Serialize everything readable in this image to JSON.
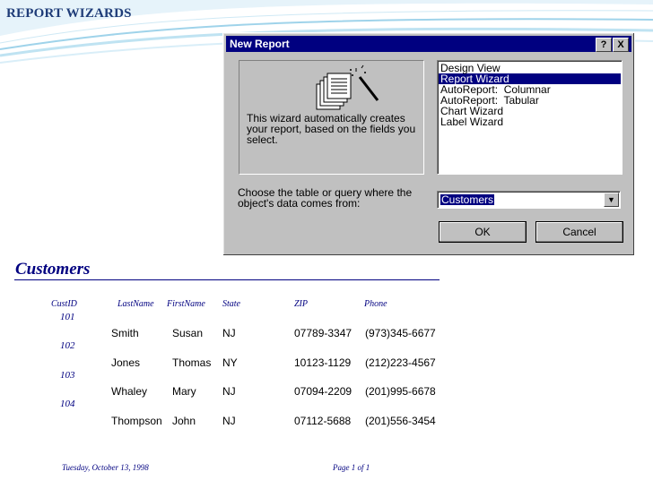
{
  "slide": {
    "title": "REPORT WIZARDS"
  },
  "dialog": {
    "title": "New Report",
    "help_glyph": "?",
    "close_glyph": "X",
    "description": "This wizard automatically creates your report, based on the fields you select.",
    "list_items": [
      "Design View",
      "Report Wizard",
      "AutoReport:  Columnar",
      "AutoReport:  Tabular",
      "Chart Wizard",
      "Label Wizard"
    ],
    "selected_index": 1,
    "choose_label": "Choose the table or query where the object's data comes from:",
    "combo_value": "Customers",
    "ok_label": "OK",
    "cancel_label": "Cancel"
  },
  "report": {
    "title": "Customers",
    "headers": [
      "CustID",
      "LastName",
      "FirstName",
      "State",
      "ZIP",
      "Phone"
    ],
    "rows": [
      {
        "id": "101",
        "last": "Smith",
        "first": "Susan",
        "state": "NJ",
        "zip": "07789-3347",
        "phone": "(973)345-6677"
      },
      {
        "id": "102",
        "last": "Jones",
        "first": "Thomas",
        "state": "NY",
        "zip": "10123-1129",
        "phone": "(212)223-4567"
      },
      {
        "id": "103",
        "last": "Whaley",
        "first": "Mary",
        "state": "NJ",
        "zip": "07094-2209",
        "phone": "(201)995-6678"
      },
      {
        "id": "104",
        "last": "Thompson",
        "first": "John",
        "state": "NJ",
        "zip": "07112-5688",
        "phone": "(201)556-3454"
      }
    ],
    "footer_date": "Tuesday, October 13, 1998",
    "footer_page": "Page 1 of 1"
  },
  "colors": {
    "title_bar": "#000080",
    "dialog_face": "#c0c0c0",
    "slide_title": "#1f3c78"
  }
}
